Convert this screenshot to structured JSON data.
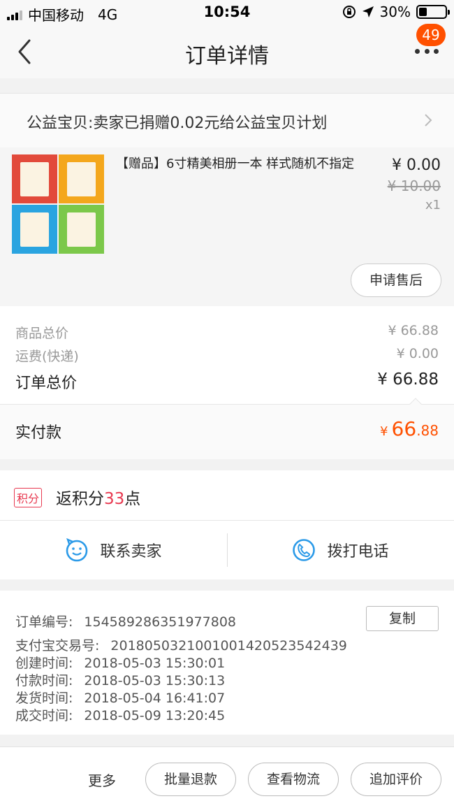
{
  "status_bar": {
    "carrier": "中国移动",
    "network": "4G",
    "time": "10:54",
    "battery": "30%",
    "battery_level": 0.3
  },
  "nav": {
    "title": "订单详情",
    "badge": "49"
  },
  "charity": {
    "text": "公益宝贝:卖家已捐赠0.02元给公益宝贝计划"
  },
  "product": {
    "title": "【赠品】6寸精美相册一本  样式随机不指定",
    "price": "¥ 0.00",
    "original_price": "¥ 10.00",
    "quantity": "x1",
    "after_sale_label": "申请售后"
  },
  "totals": {
    "goods_label": "商品总价",
    "goods_value": "¥ 66.88",
    "shipping_label": "运费(快递)",
    "shipping_value": "¥ 0.00",
    "order_total_label": "订单总价",
    "order_total_value": "¥ 66.88",
    "paid_label": "实付款",
    "paid_currency": "¥",
    "paid_integer": "66",
    "paid_decimal": ".88"
  },
  "points": {
    "tag": "积分",
    "prefix": "返积分",
    "value": "33",
    "suffix": "点"
  },
  "contact": {
    "seller_label": "联系卖家",
    "phone_label": "拨打电话"
  },
  "order_info": {
    "copy_label": "复制",
    "rows": [
      {
        "label": "订单编号:",
        "value": "154589286351977808"
      },
      {
        "label": "支付宝交易号:",
        "value": "2018050321001001420523542439"
      },
      {
        "label": "创建时间:",
        "value": "2018-05-03 15:30:01"
      },
      {
        "label": "付款时间:",
        "value": "2018-05-03 15:30:13"
      },
      {
        "label": "发货时间:",
        "value": "2018-05-04 16:41:07"
      },
      {
        "label": "成交时间:",
        "value": "2018-05-09 13:20:45"
      }
    ]
  },
  "bottom_bar": {
    "more_label": "更多",
    "refund_label": "批量退款",
    "logistics_label": "查看物流",
    "review_label": "追加评价"
  },
  "colors": {
    "accent": "#ff5000",
    "points": "#e8384f",
    "contact_icon": "#2b9ae8"
  }
}
